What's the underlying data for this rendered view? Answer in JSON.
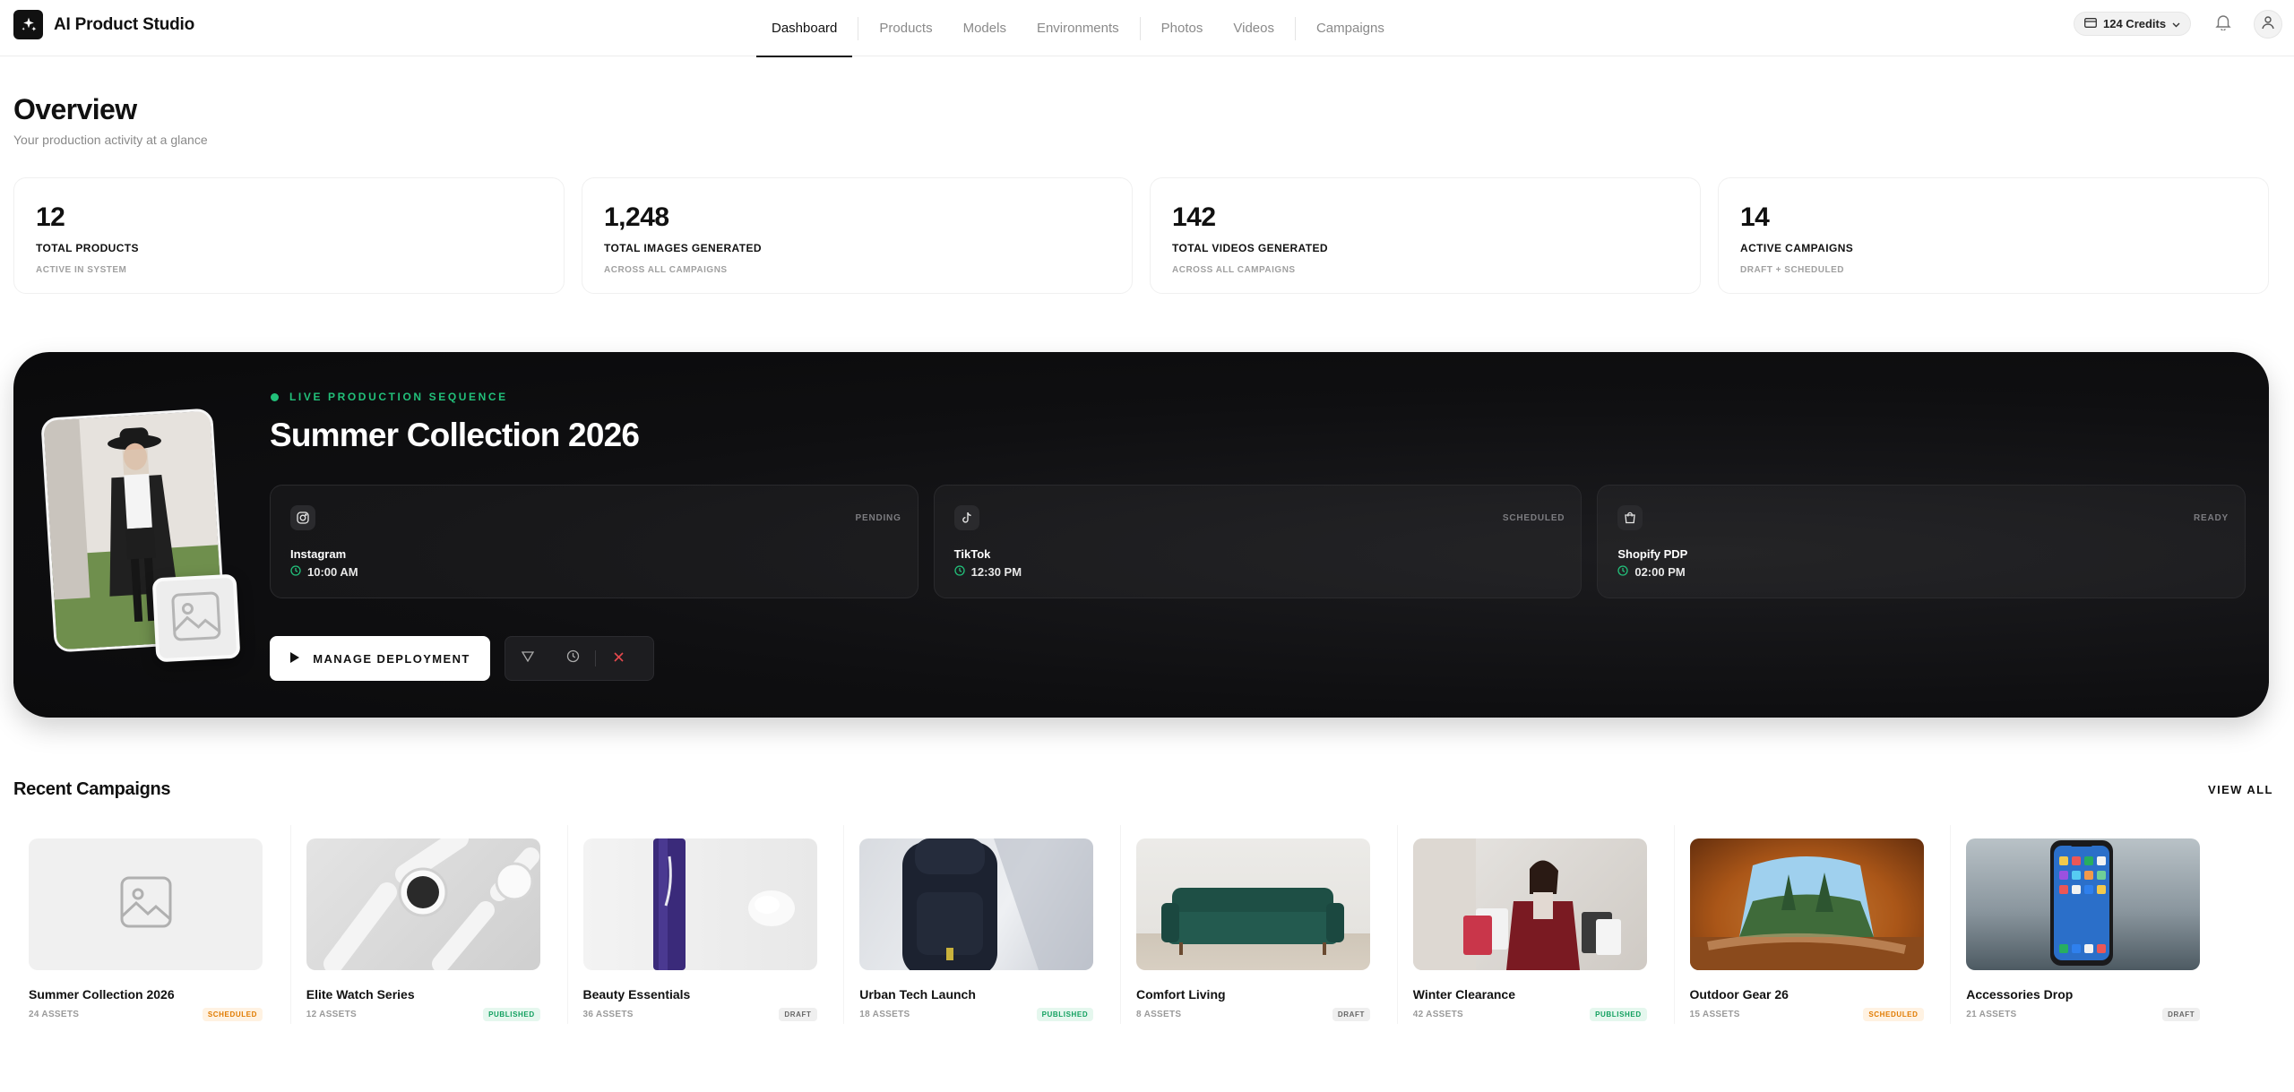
{
  "app": {
    "title": "AI Product Studio"
  },
  "nav": {
    "items": [
      {
        "label": "Dashboard",
        "active": true
      },
      {
        "label": "Products"
      },
      {
        "label": "Models"
      },
      {
        "label": "Environments"
      },
      {
        "label": "Photos"
      },
      {
        "label": "Videos"
      },
      {
        "label": "Campaigns"
      }
    ]
  },
  "header": {
    "credits": "124 Credits"
  },
  "overview": {
    "title": "Overview",
    "subtitle": "Your production activity at a glance",
    "stats": [
      {
        "value": "12",
        "label": "TOTAL PRODUCTS",
        "note": "ACTIVE IN SYSTEM"
      },
      {
        "value": "1,248",
        "label": "TOTAL IMAGES GENERATED",
        "note": "ACROSS ALL CAMPAIGNS"
      },
      {
        "value": "142",
        "label": "TOTAL VIDEOS GENERATED",
        "note": "ACROSS ALL CAMPAIGNS"
      },
      {
        "value": "14",
        "label": "ACTIVE CAMPAIGNS",
        "note": "DRAFT + SCHEDULED"
      }
    ]
  },
  "hero": {
    "tag": "LIVE PRODUCTION SEQUENCE",
    "title": "Summer Collection 2026",
    "channels": [
      {
        "name": "Instagram",
        "time": "10:00 AM",
        "status": "PENDING",
        "icon": "instagram-icon"
      },
      {
        "name": "TikTok",
        "time": "12:30 PM",
        "status": "SCHEDULED",
        "icon": "tiktok-icon"
      },
      {
        "name": "Shopify PDP",
        "time": "02:00 PM",
        "status": "READY",
        "icon": "shopping-bag-icon"
      }
    ],
    "manage_label": "MANAGE DEPLOYMENT",
    "accent": "#22c07a"
  },
  "recent": {
    "title": "Recent Campaigns",
    "view_all": "VIEW ALL",
    "campaigns": [
      {
        "name": "Summer Collection 2026",
        "assets": "24 ASSETS",
        "status": "SCHEDULED"
      },
      {
        "name": "Elite Watch Series",
        "assets": "12 ASSETS",
        "status": "PUBLISHED"
      },
      {
        "name": "Beauty Essentials",
        "assets": "36 ASSETS",
        "status": "DRAFT"
      },
      {
        "name": "Urban Tech Launch",
        "assets": "18 ASSETS",
        "status": "PUBLISHED"
      },
      {
        "name": "Comfort Living",
        "assets": "8 ASSETS",
        "status": "DRAFT"
      },
      {
        "name": "Winter Clearance",
        "assets": "42 ASSETS",
        "status": "PUBLISHED"
      },
      {
        "name": "Outdoor Gear 26",
        "assets": "15 ASSETS",
        "status": "SCHEDULED"
      },
      {
        "name": "Accessories Drop",
        "assets": "21 ASSETS",
        "status": "DRAFT"
      }
    ]
  }
}
